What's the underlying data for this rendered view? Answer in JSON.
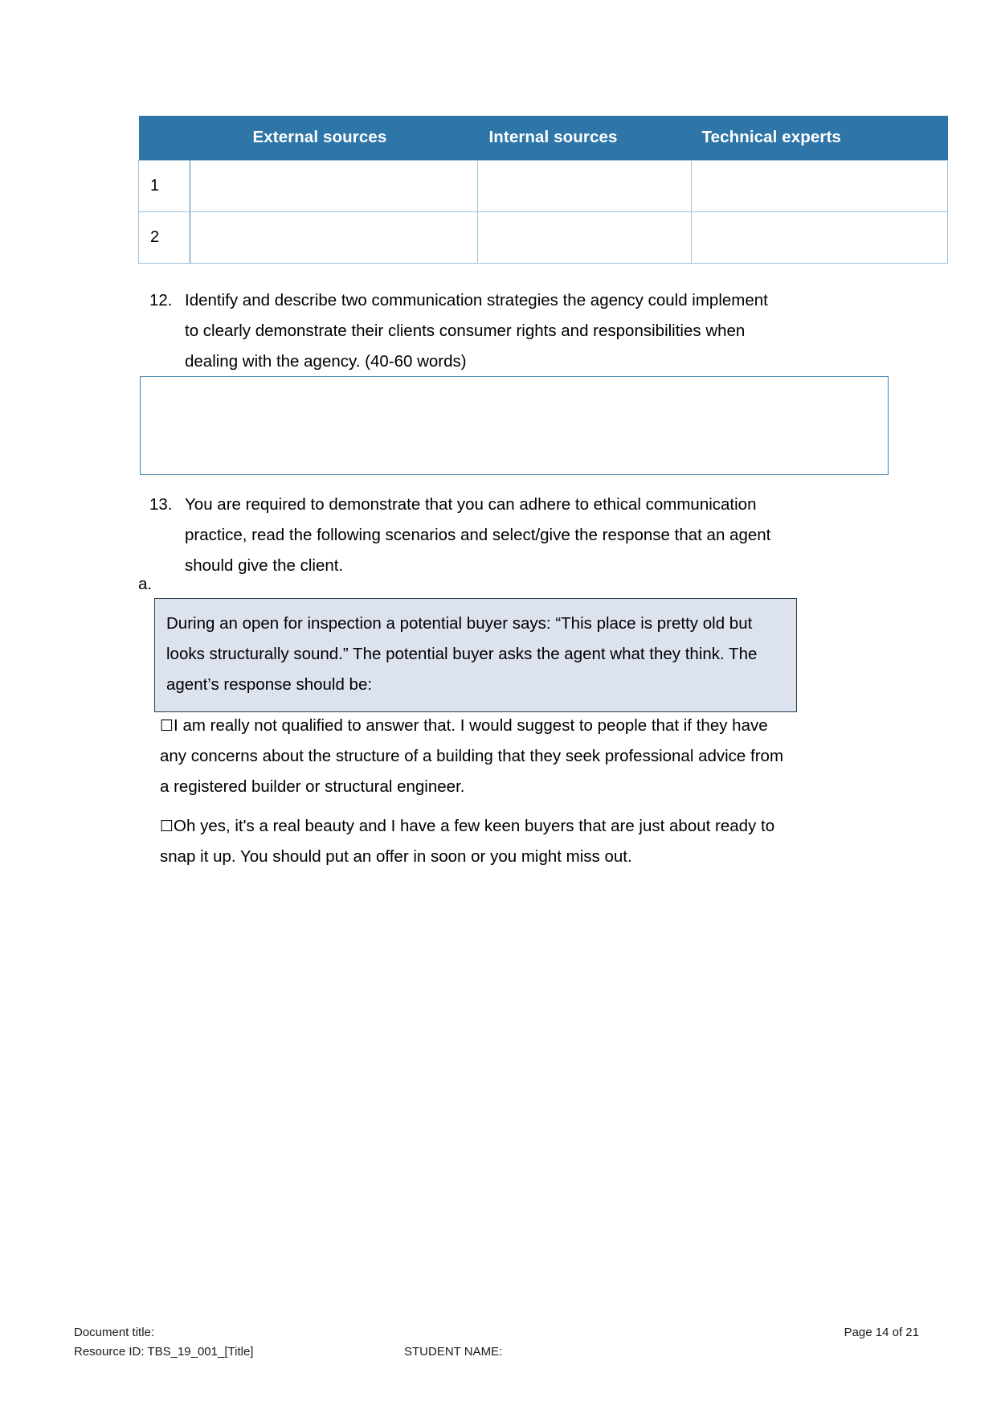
{
  "document": {
    "page_label": "Page 14 of 21"
  },
  "sources_table": {
    "headers": [
      "",
      "External sources",
      "Internal sources",
      "Technical experts"
    ],
    "rows": [
      {
        "number": "1",
        "external": "",
        "internal": "",
        "technical": ""
      },
      {
        "number": "2",
        "external": "",
        "internal": "",
        "technical": ""
      }
    ],
    "header_bg": "#2E76A8",
    "header_text_color": "#FFFFFF",
    "cell_border_color": "#9FC2D8"
  },
  "question_12": {
    "number": "12.",
    "text": "Identify and describe two communication strategies the agency could implement to clearly demonstrate their clients consumer rights and responsibilities when dealing with the agency. (40-60 words)",
    "answer_value": "",
    "answer_placeholder": ""
  },
  "question_13": {
    "number": "13.",
    "text": "You are required to demonstrate that you can adhere to ethical communication practice, read the following scenarios and select/give the response that an agent should give the client.",
    "sub_item_letter": "a.",
    "scenario": "During an open for inspection a potential buyer says: “This place is pretty old but looks structurally sound.” The potential buyer asks the agent what they think. The agent’s response should be:",
    "scenario_bg": "#DCE3EF",
    "scenario_border": "#2E3B4E",
    "options": [
      {
        "checkbox": "☐",
        "checked": false,
        "text": "I am really not qualified to answer that. I would suggest to people that if they have any concerns about the structure of a building that they seek professional advice from a registered builder or structural engineer."
      },
      {
        "checkbox": "☐",
        "checked": false,
        "text": "Oh yes, it's a real beauty and I have a few keen buyers that are just about ready to snap it up. You should put an offer in soon or you might miss out."
      }
    ]
  },
  "footer": {
    "document_title_label": "Document title:",
    "resource_id": "Resource ID: TBS_19_001_[Title]",
    "student_name_label": "STUDENT NAME:",
    "page_number": "Page 14 of 21"
  }
}
